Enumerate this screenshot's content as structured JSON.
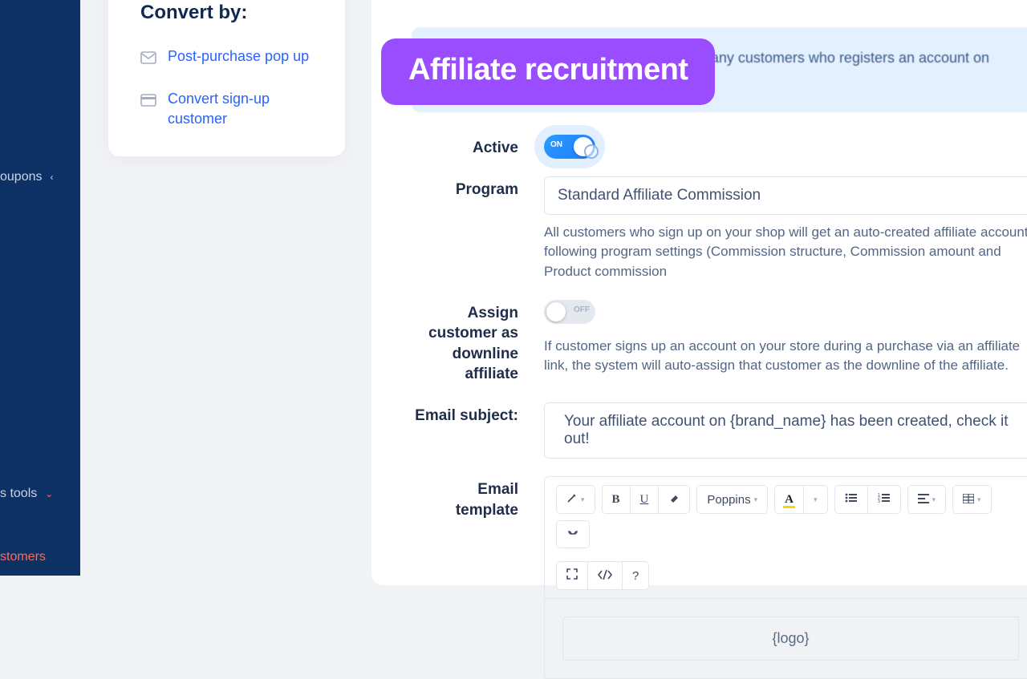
{
  "leftnav": {
    "coupons": "oupons",
    "tools": "s tools",
    "customers": "stomers"
  },
  "sidecard": {
    "title": "Convert by:",
    "item1": "Post-purchase pop up",
    "item2": "Convert sign-up customer"
  },
  "overlay_badge": "Affiliate recruitment",
  "info_banner": "automatically create an affiliate account on any customers who registers an account on your shop.",
  "form": {
    "active_label": "Active",
    "active_toggle_text": "ON",
    "program_label": "Program",
    "program_value": "Standard Affiliate Commission",
    "program_hint": "All customers who sign up on your shop will get an auto-created affiliate account following program settings (Commission structure, Commission amount and Product commission",
    "assign_label": "Assign customer as downline affiliate",
    "assign_toggle_text": "OFF",
    "assign_hint": "If customer signs up an account on your store during a purchase via an affiliate link, the system will auto-assign that customer as the downline of the affiliate.",
    "subject_label": "Email subject:",
    "subject_value": "Your affiliate account on {brand_name} has been created, check it out!",
    "template_label": "Email template",
    "editor_logo": "{logo}"
  },
  "toolbar": {
    "font": "Poppins",
    "bold": "B",
    "underline": "U",
    "color": "A",
    "help": "?"
  }
}
